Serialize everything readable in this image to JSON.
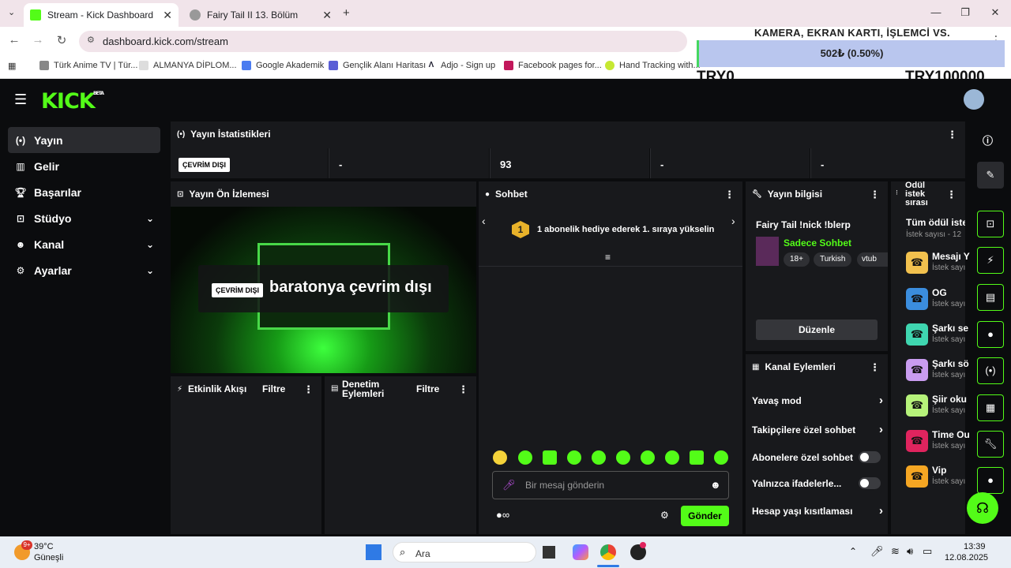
{
  "browser": {
    "tabs": [
      {
        "label": "Stream - Kick Dashboard",
        "active": true
      },
      {
        "label": "Fairy Tail II 13. Bölüm",
        "active": false
      }
    ],
    "url": "dashboard.kick.com/stream",
    "bookmarks": [
      "Türk Anime TV | Tür...",
      "ALMANYA DİPLOM...",
      "Google Akademik",
      "Gençlik Alanı Haritası",
      "Adjo - Sign up",
      "Facebook pages for...",
      "Hand Tracking with..."
    ]
  },
  "overlay": {
    "title": "KAMERA, EKRAN KARTI, İŞLEMCİ VS.",
    "progress_label": "502₺ (0.50%)",
    "progress": 0.005,
    "min_label": "TRY0",
    "max_label": "TRY100000"
  },
  "app": {
    "logo": "KICK",
    "logo_badge": "BETA",
    "sidebar": [
      {
        "label": "Yayın",
        "icon": "broadcast-icon",
        "active": true
      },
      {
        "label": "Gelir",
        "icon": "chart-icon"
      },
      {
        "label": "Başarılar",
        "icon": "trophy-icon"
      },
      {
        "label": "Stüdyo",
        "icon": "studio-icon",
        "expandable": true
      },
      {
        "label": "Kanal",
        "icon": "users-icon",
        "expandable": true
      },
      {
        "label": "Ayarlar",
        "icon": "gear-icon",
        "expandable": true
      }
    ],
    "stats": {
      "title": "Yayın İstatistikleri",
      "status": "ÇEVRİM DIŞI",
      "values": [
        "-",
        "93",
        "-",
        "-"
      ]
    },
    "preview": {
      "title": "Yayın Ön İzlemesi",
      "badge": "ÇEVRİM DIŞI",
      "message": "baratonya çevrim dışı"
    },
    "activity": {
      "title": "Etkinlik Akışı",
      "filter": "Filtre"
    },
    "moderation": {
      "title_line1": "Denetim",
      "title_line2": "Eylemleri",
      "filter": "Filtre"
    },
    "chat": {
      "title": "Sohbet",
      "banner_rank": "1",
      "banner": "1 abonelik hediye ederek 1. sıraya yükselin",
      "placeholder": "Bir mesaj gönderin",
      "send": "Gönder"
    },
    "stream_info": {
      "title": "Yayın bilgisi",
      "stream_title": "Fairy Tail !nick !blerp",
      "category": "Sadece Sohbet",
      "tags": [
        "18+",
        "Turkish",
        "vtub"
      ],
      "edit": "Düzenle"
    },
    "channel_actions": {
      "title": "Kanal Eylemleri",
      "items": [
        {
          "label": "Yavaş mod",
          "control": "chevron"
        },
        {
          "label": "Takipçilere özel sohbet",
          "control": "chevron"
        },
        {
          "label": "Abonelere özel sohbet",
          "control": "toggle"
        },
        {
          "label": "Yalnızca ifadelerle...",
          "control": "toggle"
        },
        {
          "label": "Hesap yaşı kısıtlaması",
          "control": "chevron"
        }
      ]
    },
    "rewards": {
      "title_line1": "Ödül",
      "title_line2": "istek",
      "title_line3": "sırası",
      "all_label": "Tüm ödül iste",
      "all_count": "İstek sayısı - 12",
      "items": [
        {
          "label": "Mesajı Y",
          "sub": "İstek sayı",
          "color": "#f2c14e"
        },
        {
          "label": "OG",
          "sub": "İstek sayı",
          "color": "#3b8dde"
        },
        {
          "label": "Şarkı se",
          "sub": "İstek sayı",
          "color": "#3fd6b0"
        },
        {
          "label": "Şarkı sö",
          "sub": "İstek sayı",
          "color": "#c99cf0"
        },
        {
          "label": "Şiir oku",
          "sub": "İstek sayı",
          "color": "#b6f27a"
        },
        {
          "label": "Time Ou",
          "sub": "İstek sayı",
          "color": "#e0245e"
        },
        {
          "label": "Vip",
          "sub": "İstek sayı",
          "color": "#f5a623"
        }
      ]
    }
  },
  "taskbar": {
    "weather_temp": "39°C",
    "weather_desc": "Güneşli",
    "weather_badge": "9+",
    "search": "Ara",
    "time": "13:39",
    "date": "12.08.2025"
  }
}
